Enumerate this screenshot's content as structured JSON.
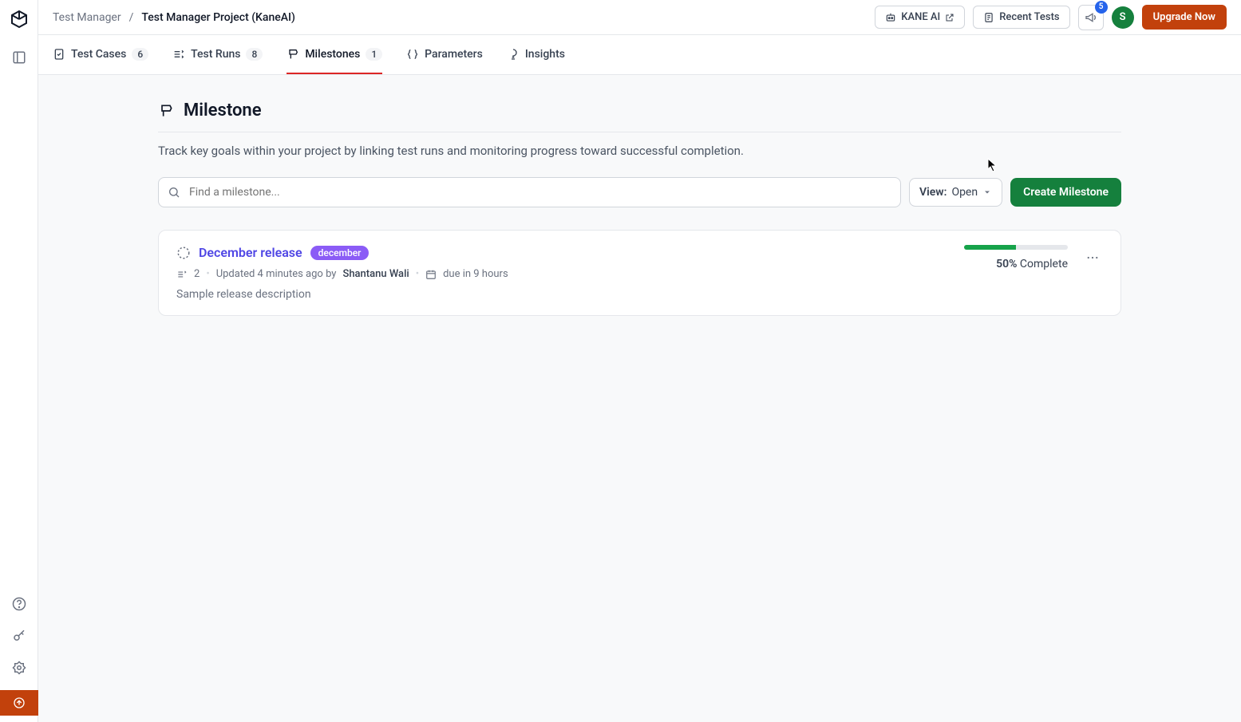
{
  "breadcrumb": {
    "root": "Test Manager",
    "sep": "/",
    "current": "Test Manager Project (KaneAI)"
  },
  "topbar": {
    "kane_ai": "KANE AI",
    "recent_tests": "Recent Tests",
    "notif_count": "5",
    "avatar_initial": "S",
    "upgrade": "Upgrade Now"
  },
  "tabs": {
    "test_cases": {
      "label": "Test Cases",
      "count": "6"
    },
    "test_runs": {
      "label": "Test Runs",
      "count": "8"
    },
    "milestones": {
      "label": "Milestones",
      "count": "1"
    },
    "parameters": {
      "label": "Parameters"
    },
    "insights": {
      "label": "Insights"
    }
  },
  "page": {
    "title": "Milestone",
    "description": "Track key goals within your project by linking test runs and monitoring progress toward successful completion."
  },
  "toolbar": {
    "search_placeholder": "Find a milestone...",
    "view_label": "View:",
    "view_value": "Open",
    "create": "Create Milestone"
  },
  "milestone": {
    "title": "December release",
    "tag": "december",
    "run_count": "2",
    "updated": "Updated 4 minutes ago by",
    "author": "Shantanu Wali",
    "due": "due in 9 hours",
    "description": "Sample release description",
    "progress_pct": "50%",
    "progress_label": "Complete",
    "progress_width": "50%"
  }
}
